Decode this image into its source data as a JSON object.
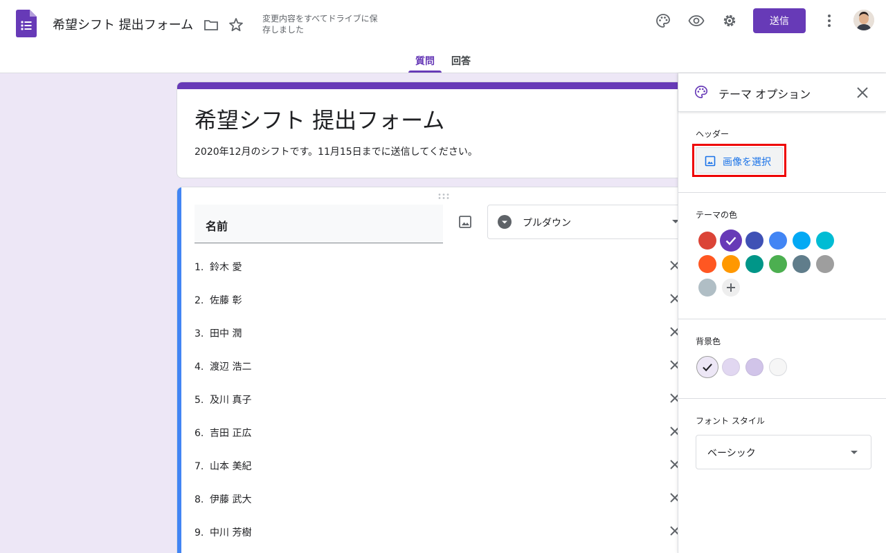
{
  "header": {
    "title": "希望シフト 提出フォーム",
    "saved_status": "変更内容をすべてドライブに保存しました",
    "send_label": "送信",
    "icons": [
      "palette-icon",
      "preview-icon",
      "settings-icon",
      "more-icon"
    ]
  },
  "tabs": [
    {
      "label": "質問",
      "active": true
    },
    {
      "label": "回答",
      "active": false
    }
  ],
  "form": {
    "title": "希望シフト 提出フォーム",
    "description": "2020年12月のシフトです。11月15日までに送信してください。"
  },
  "question": {
    "title": "名前",
    "type": "プルダウン",
    "options": [
      {
        "num": "1.",
        "label": "鈴木 愛"
      },
      {
        "num": "2.",
        "label": "佐藤 彰"
      },
      {
        "num": "3.",
        "label": "田中 潤"
      },
      {
        "num": "4.",
        "label": "渡辺 浩二"
      },
      {
        "num": "5.",
        "label": "及川 真子"
      },
      {
        "num": "6.",
        "label": "吉田 正広"
      },
      {
        "num": "7.",
        "label": "山本 美紀"
      },
      {
        "num": "8.",
        "label": "伊藤 武大"
      },
      {
        "num": "9.",
        "label": "中川 芳樹"
      }
    ]
  },
  "theme_panel": {
    "title": "テーマ オプション",
    "header_label": "ヘッダー",
    "select_image_label": "画像を選択",
    "theme_color_label": "テーマの色",
    "theme_colors": [
      "#db4437",
      "#673ab7",
      "#3f51b5",
      "#4285f4",
      "#03a9f4",
      "#00bcd4",
      "#ff5722",
      "#ff9800",
      "#009688",
      "#4caf50",
      "#607d8b",
      "#9e9e9e",
      "#b0bec5"
    ],
    "selected_theme_color": "#673ab7",
    "background_label": "背景色",
    "background_colors": [
      "#ede7f6",
      "#e1d7f1",
      "#d1c4e9",
      "#f6f6f6"
    ],
    "selected_background_color": "#ede7f6",
    "font_style_label": "フォント スタイル",
    "font_style_value": "ベーシック"
  }
}
